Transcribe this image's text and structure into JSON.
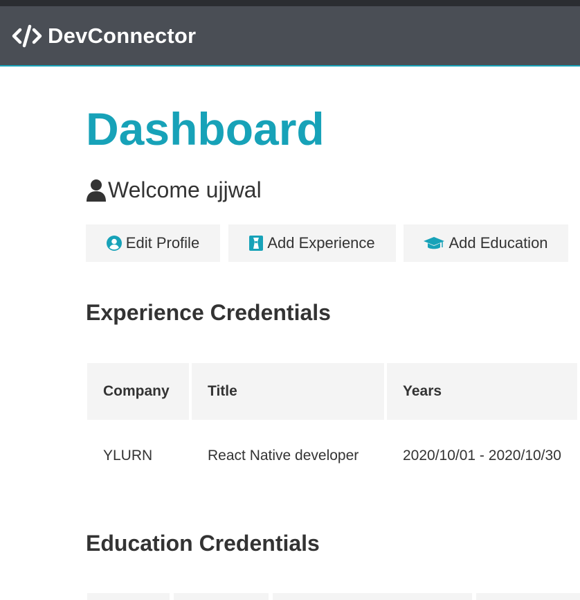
{
  "navbar": {
    "brand": "DevConnector",
    "brand_icon": "code-icon",
    "background": "#4a4e55",
    "accent": "#17a2b8"
  },
  "dashboard": {
    "title": "Dashboard",
    "welcome": "Welcome ujjwal",
    "welcome_icon": "user-icon"
  },
  "actions": [
    {
      "label": "Edit Profile",
      "icon": "user-circle-icon"
    },
    {
      "label": "Add Experience",
      "icon": "briefcase-icon"
    },
    {
      "label": "Add Education",
      "icon": "graduation-cap-icon"
    }
  ],
  "experience": {
    "heading": "Experience Credentials",
    "columns": [
      "Company",
      "Title",
      "Years"
    ],
    "rows": [
      {
        "company": "YLURN",
        "title": "React Native developer",
        "years": "2020/10/01 - 2020/10/30"
      }
    ]
  },
  "education": {
    "heading": "Education Credentials"
  },
  "colors": {
    "primary": "#17a2b8",
    "light": "#f4f4f4",
    "dark": "#333333"
  }
}
